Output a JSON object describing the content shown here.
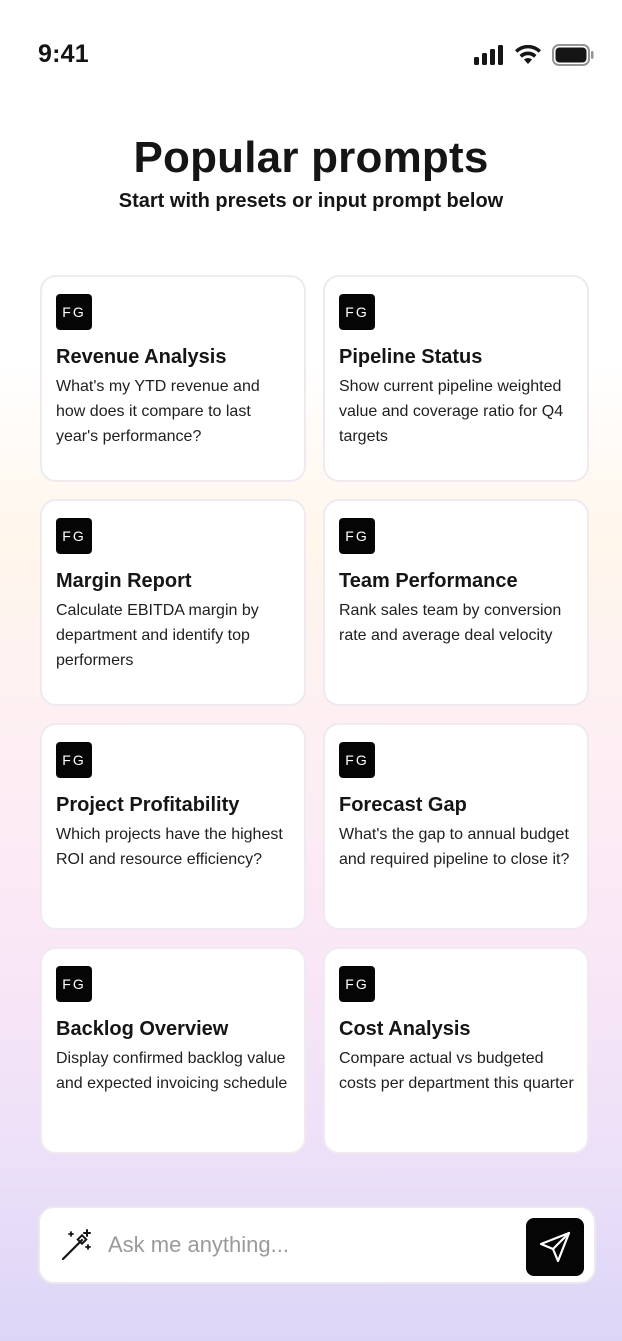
{
  "status": {
    "time": "9:41"
  },
  "header": {
    "title": "Popular prompts",
    "subtitle": "Start with presets or input prompt below"
  },
  "cards": [
    {
      "badge": "FG",
      "title": "Revenue Analysis",
      "desc": "What's my YTD revenue and how does it compare to last year's performance?"
    },
    {
      "badge": "FG",
      "title": "Pipeline Status",
      "desc": "Show current pipeline weighted value and coverage ratio for Q4 targets"
    },
    {
      "badge": "FG",
      "title": "Margin Report",
      "desc": "Calculate EBITDA margin by department and identify top performers"
    },
    {
      "badge": "FG",
      "title": "Team Performance",
      "desc": "Rank sales team by conversion rate and average deal velocity"
    },
    {
      "badge": "FG",
      "title": "Project Profitability",
      "desc": "Which projects have the highest ROI and resource efficiency?"
    },
    {
      "badge": "FG",
      "title": "Forecast Gap",
      "desc": "What's the gap to annual budget and required pipeline to close it?"
    },
    {
      "badge": "FG",
      "title": "Backlog Overview",
      "desc": "Display confirmed backlog value and expected invoicing schedule"
    },
    {
      "badge": "FG",
      "title": "Cost Analysis",
      "desc": "Compare actual vs budgeted costs per department this quarter"
    }
  ],
  "input": {
    "placeholder": "Ask me anything..."
  },
  "icons": {
    "signal": "cellular-signal-icon",
    "wifi": "wifi-icon",
    "battery": "battery-icon",
    "wand": "magic-wand-icon",
    "send": "send-icon"
  }
}
